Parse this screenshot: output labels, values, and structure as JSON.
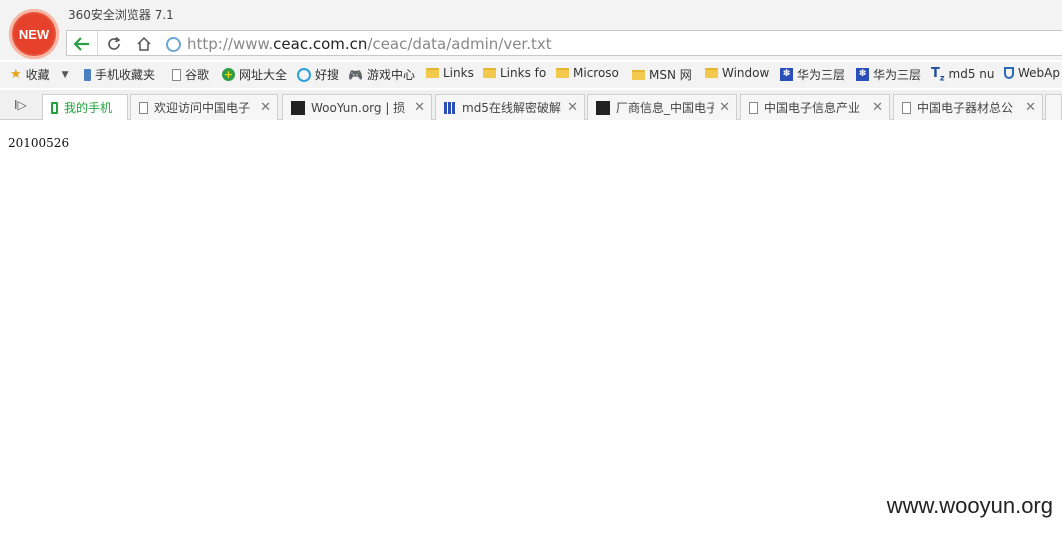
{
  "app": {
    "title": "360安全浏览器 7.1",
    "logo_text": "NEW"
  },
  "address_bar": {
    "url_prefix": "http://www.",
    "url_host": "ceac.com.cn",
    "url_path": "/ceac/data/admin/ver.txt"
  },
  "bookmarks": [
    {
      "label": "收藏",
      "icon": "star-icon"
    },
    {
      "label": "手机收藏夹",
      "icon": "phone-icon"
    },
    {
      "label": "谷歌",
      "icon": "page-icon"
    },
    {
      "label": "网址大全",
      "icon": "plus-globe-icon"
    },
    {
      "label": "好搜",
      "icon": "search-q-icon"
    },
    {
      "label": "游戏中心",
      "icon": "gamepad-icon"
    },
    {
      "label": "Links",
      "icon": "folder-icon"
    },
    {
      "label": "Links fo",
      "icon": "folder-icon"
    },
    {
      "label": "Microso",
      "icon": "folder-icon"
    },
    {
      "label": "MSN 网",
      "icon": "folder-icon"
    },
    {
      "label": "Window",
      "icon": "folder-icon"
    },
    {
      "label": "华为三层",
      "icon": "paw-icon"
    },
    {
      "label": "华为三层",
      "icon": "paw-icon"
    },
    {
      "label": "md5 nu",
      "icon": "tz-icon"
    },
    {
      "label": "WebAp",
      "icon": "shield-icon"
    }
  ],
  "tabs": [
    {
      "label": "我的手机",
      "active": true,
      "icon": "phone-icon"
    },
    {
      "label": "欢迎访问中国电子",
      "icon": "page-icon"
    },
    {
      "label": "WooYun.org | 损",
      "icon": "wooyun-icon"
    },
    {
      "label": "md5在线解密破解",
      "icon": "grid-icon"
    },
    {
      "label": "厂商信息_中国电子",
      "icon": "wooyun-icon"
    },
    {
      "label": "中国电子信息产业",
      "icon": "page-icon"
    },
    {
      "label": "中国电子器材总公",
      "icon": "page-icon"
    }
  ],
  "page": {
    "content": "20100526",
    "watermark": "www.wooyun.org"
  },
  "colors": {
    "active_tab_text": "#22a33d",
    "logo_red": "#e5412b",
    "folder_yellow": "#f2c94c"
  }
}
